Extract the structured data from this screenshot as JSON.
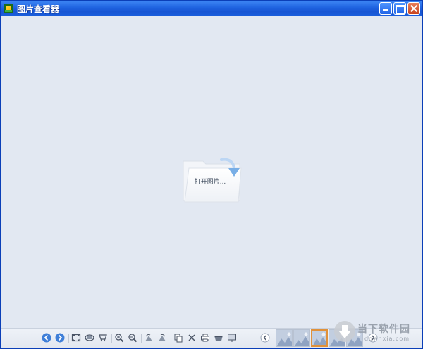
{
  "window": {
    "title": "图片查看器",
    "colors": {
      "titlebar": "#1f63e0",
      "background": "#e2e8f2",
      "accent": "#e0913a"
    }
  },
  "viewer": {
    "open_label": "打开图片..."
  },
  "toolbar": {
    "buttons": [
      {
        "name": "previous-button",
        "icon": "arrow-left-circle-icon"
      },
      {
        "name": "next-button",
        "icon": "arrow-right-circle-icon"
      },
      {
        "name": "fit-window-button",
        "icon": "fit-screen-icon"
      },
      {
        "name": "actual-size-button",
        "icon": "actual-size-icon"
      },
      {
        "name": "fullscreen-button",
        "icon": "fullscreen-icon"
      },
      {
        "name": "zoom-in-button",
        "icon": "zoom-in-icon"
      },
      {
        "name": "zoom-out-button",
        "icon": "zoom-out-icon"
      },
      {
        "name": "rotate-left-button",
        "icon": "rotate-left-icon"
      },
      {
        "name": "rotate-right-button",
        "icon": "rotate-right-icon"
      },
      {
        "name": "copy-button",
        "icon": "copy-icon"
      },
      {
        "name": "delete-button",
        "icon": "delete-x-icon"
      },
      {
        "name": "print-button",
        "icon": "print-icon"
      },
      {
        "name": "save-button",
        "icon": "save-icon"
      },
      {
        "name": "wallpaper-button",
        "icon": "wallpaper-icon"
      }
    ],
    "thumbnails_prev": "chevron-left-icon",
    "thumbnails_next": "chevron-right-icon",
    "thumbnail_count": 5,
    "active_thumbnail": 3
  },
  "watermark": {
    "text": "当下软件园",
    "sub": "downxia.com"
  }
}
